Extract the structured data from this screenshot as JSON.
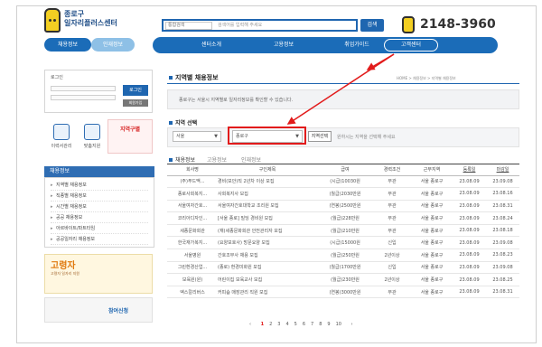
{
  "header": {
    "logo_line1": "종로구",
    "logo_line2": "일자리플러스센터",
    "search": {
      "select": "통합검색",
      "placeholder": "검색어를 입력해 주세요",
      "button": "검색"
    },
    "phone": "2148-3960"
  },
  "top_tabs": [
    {
      "label": "채용정보"
    },
    {
      "label": "인재정보"
    }
  ],
  "nav": [
    {
      "label": "센터소개"
    },
    {
      "label": "고용정보"
    },
    {
      "label": "취업가이드"
    },
    {
      "label": "고객센터"
    }
  ],
  "sidebar": {
    "login_label": "로그인",
    "login_button": "로그인",
    "join_button": "회원가입",
    "quick_links": [
      {
        "label": "이력서관리"
      },
      {
        "label": "맞춤지원"
      }
    ],
    "highlight_box": "지역구별",
    "menu_title": "채용정보",
    "menu_items": [
      {
        "label": "지역별 채용정보"
      },
      {
        "label": "직종별 채용정보"
      },
      {
        "label": "시간별 채용정보"
      },
      {
        "label": "공공 채용정보"
      },
      {
        "label": "아르바이트/파트타임"
      },
      {
        "label": "공공일자리 채용정보"
      }
    ],
    "banner_title": "고령자",
    "banner_sub": "고령자 일자리 지원",
    "banner2_title": "참여신청"
  },
  "main": {
    "title": "지역별 채용정보",
    "breadcrumb": "HOME > 채용정보 > 지역별 채용정보",
    "intro": "종로구는 서울시 지역별로 일자리정보를 확인할 수 있습니다.",
    "region_title": "지역 선택",
    "region_select1": "서울",
    "region_select2": "종로구",
    "region_button": "지역선택",
    "region_note": "원하시는 지역을 선택해 주세요",
    "subtabs": [
      {
        "label": "채용정보"
      },
      {
        "label": "고용정보"
      },
      {
        "label": "인재정보"
      }
    ],
    "columns": [
      "회사명",
      "구인제목",
      "급여",
      "경력조건",
      "근무지역",
      "등록일",
      "마감일"
    ],
    "rows": [
      [
        "(주)푸드맥...",
        "경비(보안)직 2년차 이상 모집",
        "(시급)10030원",
        "무관",
        "서울 종로구",
        "23.08.09",
        "23.09.08"
      ],
      [
        "종로사회복지...",
        "사회복지사 모집",
        "(월급)2030만원",
        "무관",
        "서울 종로구",
        "23.08.09",
        "23.08.16"
      ],
      [
        "서울여자간호...",
        "서울여자간호대학교 조리원 모집",
        "(연봉)2500만원",
        "무관",
        "서울 종로구",
        "23.08.09",
        "23.08.31"
      ],
      [
        "코리아디자인...",
        "[서울 종로] 빌딩 경비원 모집",
        "(월급)228만원",
        "무관",
        "서울 종로구",
        "23.08.09",
        "23.08.24"
      ],
      [
        "세종문화회관",
        "(재)세종문화회관 안전관리자 모집",
        "(월급)210만원",
        "무관",
        "서울 종로구",
        "23.08.09",
        "23.08.18"
      ],
      [
        "한국재가복지...",
        "(요양보호사) 방문요양 모집",
        "(시급)15000원",
        "신입",
        "서울 종로구",
        "23.08.09",
        "23.09.08"
      ],
      [
        "서울병원",
        "간호조무사 채용 모집",
        "(월급)250만원",
        "2년이상",
        "서울 종로구",
        "23.08.09",
        "23.08.23"
      ],
      [
        "그린환경산업...",
        "(종로) 환경미화원 모집",
        "(월급)1700만원",
        "신입",
        "서울 종로구",
        "23.08.09",
        "23.09.08"
      ],
      [
        "보육원(원)",
        "어린이집 보육교사 모집",
        "(월급)230만원",
        "2년이상",
        "서울 종로구",
        "23.08.09",
        "23.08.25"
      ],
      [
        "엑스칼리버스",
        "커피숍 매장관리 직원 모집",
        "(연봉)3000만원",
        "무관",
        "서울 종로구",
        "23.08.09",
        "23.08.31"
      ]
    ],
    "pager": {
      "prev": "‹",
      "pages": [
        "1",
        "2",
        "3",
        "4",
        "5",
        "6",
        "7",
        "8",
        "9",
        "10"
      ],
      "current": "1",
      "next": "›"
    }
  },
  "colors": {
    "primary": "#1b6cb8",
    "accent_red": "#e21b1b",
    "logo_yellow": "#f3cf22"
  }
}
